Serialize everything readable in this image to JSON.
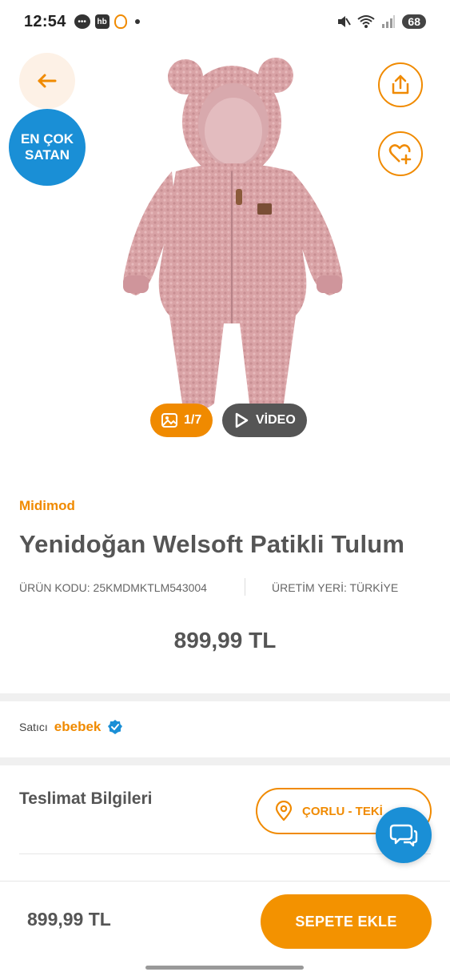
{
  "status_bar": {
    "time": "12:54",
    "hb_label": "hb",
    "battery": "68"
  },
  "hero": {
    "badge_line1": "EN ÇOK",
    "badge_line2": "SATAN",
    "gallery_count": "1/7",
    "video_label": "VİDEO"
  },
  "product": {
    "brand": "Midimod",
    "title": "Yenidoğan Welsoft Patikli Tulum",
    "code_text": "ÜRÜN KODU: 25KMDMKTLM543004",
    "origin_text": "ÜRETİM YERİ: TÜRKİYE",
    "price": "899,99 TL"
  },
  "seller": {
    "label": "Satıcı",
    "name": "ebebek"
  },
  "delivery": {
    "title": "Teslimat Bilgileri",
    "location": "ÇORLU - TEKİ"
  },
  "bottom_bar": {
    "price": "899,99 TL",
    "add_to_cart": "SEPETE EKLE"
  },
  "colors": {
    "accent": "#f08a00",
    "blue": "#1a8fd6",
    "text": "#555555"
  }
}
